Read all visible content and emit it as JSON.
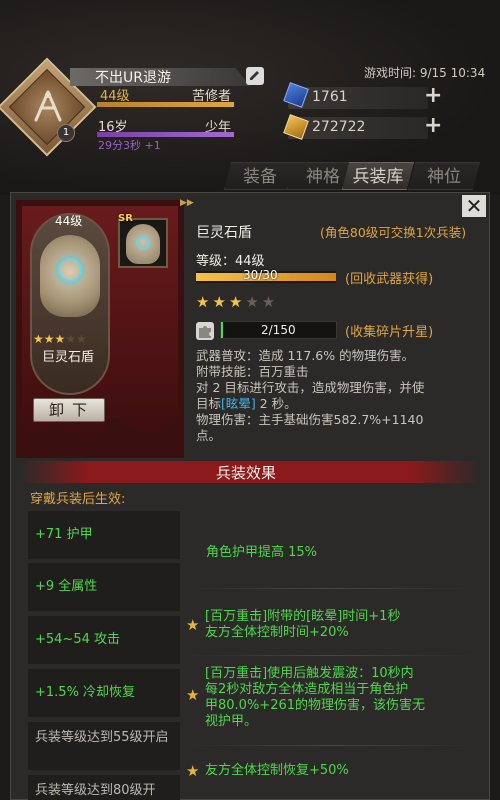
{
  "player": {
    "name": "不出UR退游",
    "level": "44级",
    "title": "苦修者",
    "age": "16岁",
    "stage": "少年",
    "age_timer": "29分3秒 +1",
    "badge_number": "1"
  },
  "game_time": "游戏时间: 9/15 10:34",
  "currency": {
    "blue": "1761",
    "gold": "272722",
    "plus": "+"
  },
  "tabs": [
    "装备",
    "神格",
    "兵装库",
    "神位"
  ],
  "active_tab": "兵装库",
  "item": {
    "level": "44级",
    "name": "巨灵石盾",
    "stars_on": "★★★",
    "stars_off": "★★",
    "rarity": "SR",
    "unequip_label": "卸下",
    "ribbon": "▶▶"
  },
  "detail": {
    "name": "巨灵石盾",
    "exchange_note": "(角色80级可交换1次兵装)",
    "level_label": "等级：44级",
    "exp_text": "30/30",
    "recycle_note": "(回收武器获得)",
    "stars_on": "★★★",
    "stars_off": "★★",
    "fragment_text": "2/150",
    "fragment_note": "(收集碎片升星)",
    "desc_line1": "武器普攻：造成 117.6% 的物理伤害。",
    "desc_line2": "附带技能：百万重击",
    "desc_line3a": "对 2 目标进行攻击，造成物理伤害，并使",
    "desc_line3b_pre": "目标",
    "desc_dizzy": "[眩晕]",
    "desc_line3b_post": " 2 秒。",
    "desc_line4": "物理伤害：主手基础伤害582.7%+1140",
    "desc_line5": "点。",
    "close": "✕"
  },
  "effects": {
    "title": "兵装效果",
    "subtitle": "穿戴兵装后生效:",
    "left": [
      "+71 护甲",
      "+9 全属性",
      "+54~54 攻击",
      "+1.5% 冷却恢复",
      "兵装等级达到55级开启",
      "兵装等级达到80级开"
    ],
    "right1": "角色护甲提高 15%",
    "right2_line1": "[百万重击]附带的[眩晕]时间+1秒",
    "right2_line2": "友方全体控制时间+20%",
    "right3_line1": "[百万重击]使用后触发震波：10秒内",
    "right3_line2": "每2秒对敌方全体造成相当于角色护",
    "right3_line3": "甲80.0%+261的物理伤害，该伤害无",
    "right3_line4": "视护甲。",
    "right4": "友方全体控制恢复+50%",
    "star": "★"
  }
}
